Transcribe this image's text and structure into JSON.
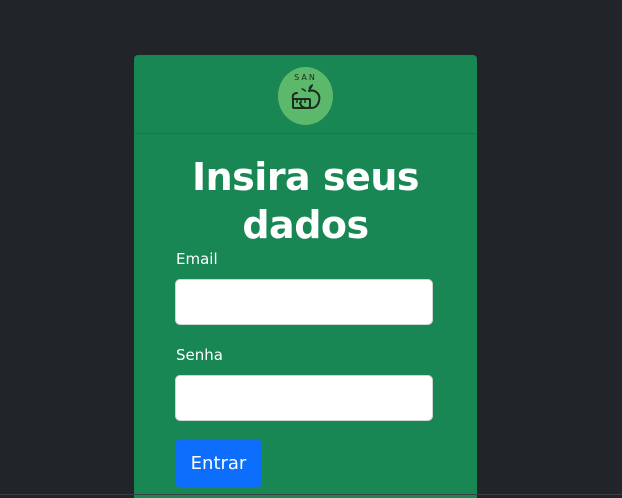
{
  "brand": {
    "logo_text": "SAN",
    "logo_icon": "apple-measuring-tape-icon",
    "logo_color": "#5cb86a"
  },
  "form": {
    "title": "Insira seus dados",
    "email_label": "Email",
    "email_value": "",
    "password_label": "Senha",
    "password_value": "",
    "submit_label": "Entrar"
  },
  "colors": {
    "background": "#212529",
    "card": "#198754",
    "button": "#0d6efd"
  }
}
